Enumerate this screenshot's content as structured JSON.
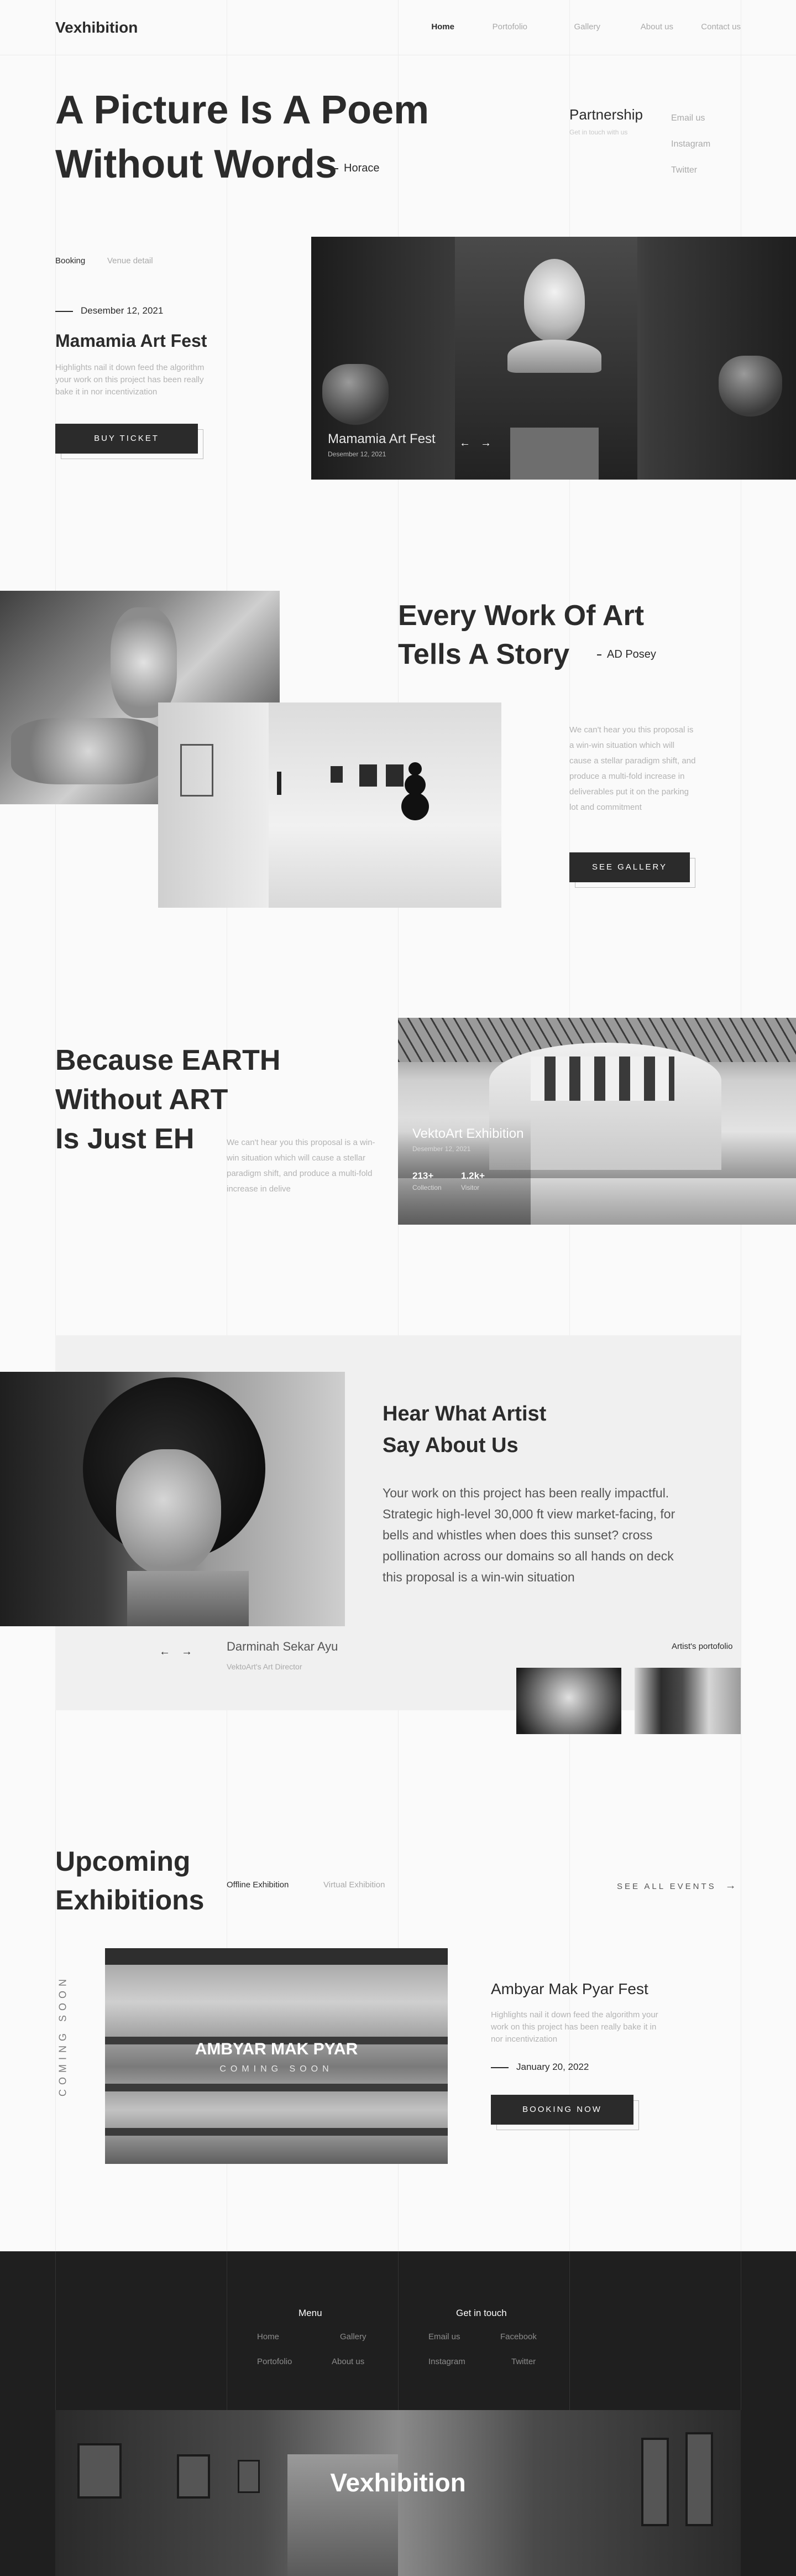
{
  "header": {
    "logo": "Vexhibition",
    "nav": [
      "Home",
      "Portofolio",
      "Gallery",
      "About us",
      "Contact us"
    ]
  },
  "hero": {
    "title_line1": "A Picture Is A Poem",
    "title_line2": "Without Words",
    "author": "Horace",
    "partnership_title": "Partnership",
    "partnership_sub": "Get in touch with us",
    "partner_links": [
      "Email us",
      "Instagram",
      "Twitter"
    ]
  },
  "event": {
    "tabs": [
      "Booking",
      "Venue detail"
    ],
    "date": "Desember 12, 2021",
    "title": "Mamamia Art Fest",
    "desc": "Highlights nail it down feed the algorithm your work on this project has been really bake it in nor incentivization",
    "button": "BUY TICKET",
    "image_caption": "Mamamia Art Fest",
    "image_date": "Desember 12, 2021"
  },
  "story": {
    "title_line1": "Every Work Of Art",
    "title_line2": "Tells A Story",
    "author": "AD Posey",
    "desc": "We can't hear you this proposal is a win-win situation which will cause a stellar paradigm shift, and produce a multi-fold increase in deliverables put it on the parking lot and commitment",
    "button": "SEE GALLERY"
  },
  "earth": {
    "title_line1": "Because EARTH",
    "title_line2": "Without ART",
    "title_line3": "Is Just EH",
    "desc": "We can't hear you this proposal is a win-win situation which will cause a stellar paradigm shift, and produce a multi-fold increase in delive",
    "image_title": "VektoArt Exhibition",
    "image_date": "Desember 12, 2021",
    "stat1_value": "213+",
    "stat1_label": "Collection",
    "stat2_value": "1.2k+",
    "stat2_label": "Visitor"
  },
  "testimonial": {
    "title_line1": "Hear What Artist",
    "title_line2": "Say About Us",
    "quote": "Your work on this project has been really impactful. Strategic high-level 30,000 ft view market-facing, for bells and whistles when does this sunset? cross pollination across our domains so all hands on deck this proposal is a win-win situation",
    "name": "Darminah Sekar Ayu",
    "role": "VektoArt's Art Director",
    "portfolio_label": "Artist's portofolio"
  },
  "upcoming": {
    "title_line1": "Upcoming",
    "title_line2": "Exhibitions",
    "tabs": [
      "Offline Exhibition",
      "Virtual Exhibition"
    ],
    "see_all": "SEE ALL EVENTS",
    "coming_soon": "COMING SOON",
    "image_title": "AMBYAR MAK PYAR",
    "image_sub": "COMING SOON",
    "event_title": "Ambyar Mak Pyar Fest",
    "event_desc": "Highlights nail it down feed the algorithm your work on this project has been really bake it in nor incentivization",
    "event_date": "January 20, 2022",
    "button": "BOOKING NOW"
  },
  "footer": {
    "menu_title": "Menu",
    "menu_items": [
      "Home",
      "Gallery",
      "Portofolio",
      "About us"
    ],
    "contact_title": "Get in touch",
    "contact_items": [
      "Email us",
      "Facebook",
      "Instagram",
      "Twitter"
    ],
    "brand": "Vexhibition"
  },
  "colors": {
    "dark": "#2b2b2b",
    "muted": "#a9a9a9",
    "background": "#fafafa",
    "footer": "#1f1f1f"
  }
}
